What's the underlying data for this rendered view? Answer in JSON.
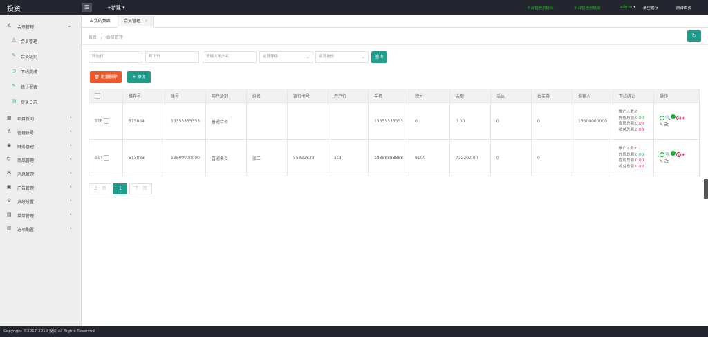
{
  "app": {
    "title": "投资"
  },
  "topbar": {
    "new_label": "+新建",
    "links": [
      "平台管理员链接",
      "平台管理员链接",
      "admin",
      "清空缓存",
      "前台首页"
    ]
  },
  "sidebar": {
    "items": [
      {
        "label": "会员管理",
        "expanded": true
      },
      {
        "label": "会员管理",
        "sub": true
      },
      {
        "label": "会员级别",
        "sub": true
      },
      {
        "label": "下线提成",
        "sub": true
      },
      {
        "label": "统计报表",
        "sub": true
      },
      {
        "label": "登录日志",
        "sub": true
      },
      {
        "label": "项目新闻"
      },
      {
        "label": "管理帐号"
      },
      {
        "label": "财务管理"
      },
      {
        "label": "商品管理"
      },
      {
        "label": "消息管理"
      },
      {
        "label": "广告管理"
      },
      {
        "label": "系统设置"
      },
      {
        "label": "菜单管理"
      },
      {
        "label": "选项配置"
      }
    ]
  },
  "tabs": [
    {
      "label": "我的桌面",
      "active": false
    },
    {
      "label": "会员管理",
      "active": true
    }
  ],
  "breadcrumb": {
    "home": "首页",
    "sep": "/",
    "current": "会员管理"
  },
  "filters": {
    "start_date": "开始日",
    "end_date": "截止日",
    "username": "请输入用户名",
    "level": "会员等级",
    "identity": "会员身份",
    "search_btn": "查询"
  },
  "actions": {
    "batch_delete": "批量删除",
    "add": "添加"
  },
  "table": {
    "headers": [
      "",
      "推荐号",
      "账号",
      "用户级别",
      "姓名",
      "银行卡号",
      "开户行",
      "手机",
      "积分",
      "余额",
      "活体",
      "抽奖券",
      "推荐人",
      "下线统计",
      "操作"
    ],
    "rows": [
      {
        "id": "118",
        "ref_code": "513884",
        "account": "13333333333",
        "level": "普通会员",
        "name": "",
        "bank_card": "",
        "bank": "",
        "phone": "13333333333",
        "points": "0",
        "balance": "0.00",
        "active": "0",
        "tickets": "0",
        "referrer": "13500000000",
        "stats": {
          "promo_label": "推广人数:",
          "promo": "0",
          "recharge_label": "充值总额:",
          "recharge": "0.00",
          "withdraw_label": "提现总额:",
          "withdraw": "0.00",
          "income_label": "收益总额:",
          "income": "0.00"
        },
        "op_text": "改"
      },
      {
        "id": "117",
        "ref_code": "513883",
        "account": "13590000000",
        "level": "普通会员",
        "name": "张三",
        "bank_card": "55332633",
        "bank": "asd",
        "phone": "18888888888",
        "points": "9100",
        "balance": "722202.00",
        "active": "0",
        "tickets": "0",
        "referrer": "",
        "stats": {
          "promo_label": "推广人数:",
          "promo": "0",
          "recharge_label": "充值总额:",
          "recharge": "0.00",
          "withdraw_label": "提现总额:",
          "withdraw": "0.00",
          "income_label": "收益总额:",
          "income": "0.00"
        },
        "op_text": "改"
      }
    ]
  },
  "pager": {
    "prev": "上一页",
    "current": "1",
    "next": "下一页"
  },
  "footer": {
    "text": "Copyright ©2017-2019 投资 All Rights Reserved"
  },
  "colors": {
    "accent": "#1e9d8b",
    "danger": "#f0582a",
    "topbar": "#23262e"
  }
}
